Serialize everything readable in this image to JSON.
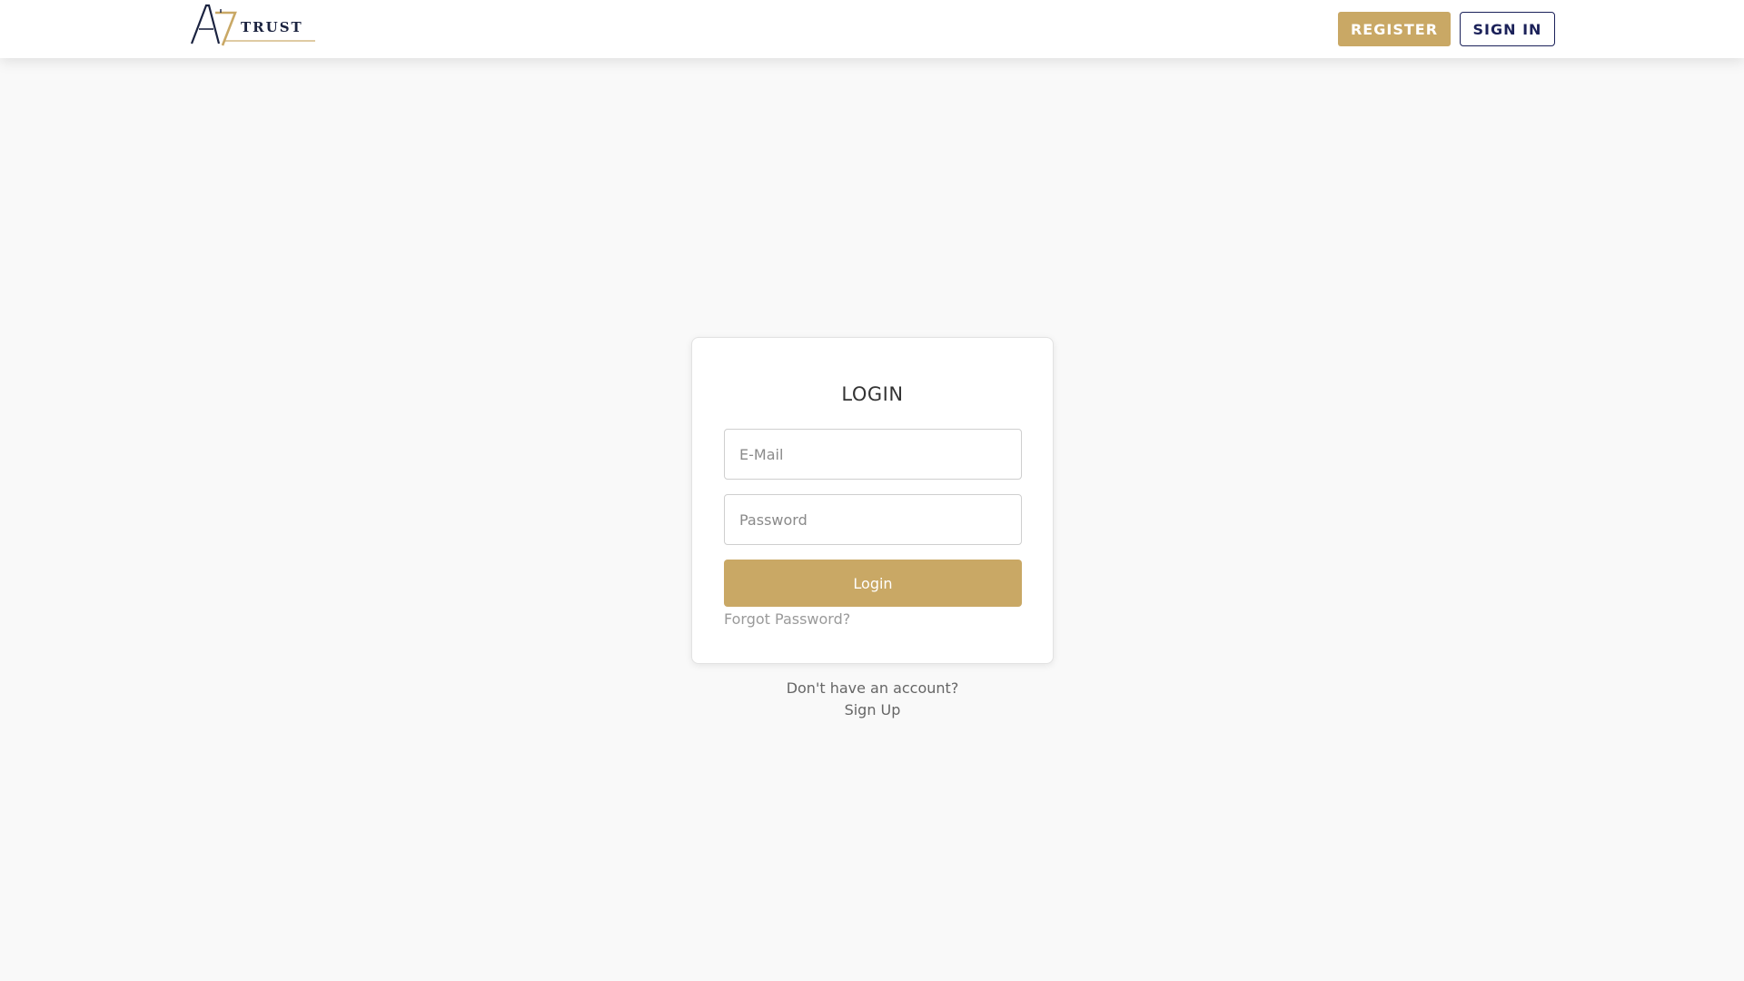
{
  "header": {
    "logo_mark": "A7",
    "logo_word": "TRUST",
    "register_label": "REGISTER",
    "signin_label": "SIGN IN"
  },
  "login_card": {
    "title": "LOGIN",
    "email_placeholder": "E-Mail",
    "email_value": "",
    "password_placeholder": "Password",
    "password_value": "",
    "login_label": "Login",
    "forgot_label": "Forgot Password?"
  },
  "signup": {
    "prompt": "Don't have an account?",
    "link_label": "Sign Up"
  },
  "colors": {
    "accent_gold": "#c9a865",
    "navy": "#1b2159",
    "background": "#f9f9f9"
  }
}
